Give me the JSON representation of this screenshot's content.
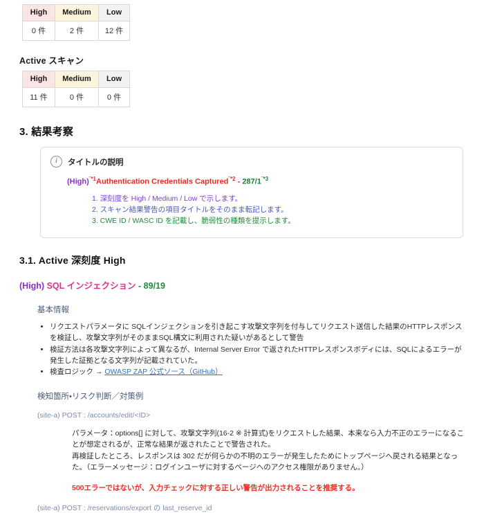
{
  "tables": [
    {
      "name": "passive-scan-summary",
      "heading": null,
      "headers": [
        "High",
        "Medium",
        "Low"
      ],
      "values": [
        "0 件",
        "2 件",
        "12 件"
      ]
    },
    {
      "name": "active-scan-summary",
      "heading": "Active スキャン",
      "headers": [
        "High",
        "Medium",
        "Low"
      ],
      "values": [
        "11 件",
        "0 件",
        "0 件"
      ]
    }
  ],
  "section3": {
    "heading": "3. 結果考察",
    "callout": {
      "icon": "info-circle-icon",
      "title": "タイトルの説明",
      "sample": {
        "severity": "(High)",
        "sup1": "¨*1",
        "name": "Authentication Credentials Captured",
        "sup2": "¨*2",
        "dash": " - ",
        "ids": "287/1",
        "sup3": "¨*3"
      },
      "notes": [
        "1. 深刻度を High / Medium / Low で示します。",
        "2. スキャン結果警告の項目タイトルをそのまま転記します。",
        "3. CWE ID / WASC ID を記載し、脆弱性の種類を提示します。"
      ]
    }
  },
  "section31": {
    "heading": "3.1. Active 深刻度 High",
    "finding": {
      "severity": "(High)",
      "name": "SQL インジェクション",
      "ids": "- 89/19"
    },
    "basic_info_heading": "基本情報",
    "bullets": [
      "リクエストパラメータに SQLインジェクションを引き起こす攻撃文字列を付与してリクエスト送信した結果のHTTPレスポンスを検証し、攻撃文字列がそのままSQL構文に利用された疑いがあるとして警告",
      "検証方法は各攻撃文字列によって異なるが、Internal Server Error で返されたHTTPレスポンスボディには、SQLによるエラーが発生した証拠となる文字列が記載されていた。"
    ],
    "bullet_link": {
      "prefix": "検査ロジック → ",
      "link_text": "OWASP ZAP 公式ソース（GitHub）"
    },
    "detect_heading": "検知箇所・リスク判断／対策例",
    "endpoints": [
      {
        "label": "(site-a) POST : /accounts/edit/<ID>",
        "paragraphs": [
          "パラメータ：options[] に対して、攻撃文字列(16-2 ※ 計算式)をリクエストした結果、本来なら入力不正のエラーになることが想定されるが、正常な結果が返されたことで警告された。",
          "再検証したところ、レスポンスは 302 だが何らかの不明のエラーが発生したためにトップページへ戻される結果となった。（エラーメッセージ：ログインユーザに対するページへのアクセス権限がありません。）"
        ],
        "warning": "500エラーではないが、入力チェックに対する正しい警告が出力されることを推奨する。"
      },
      {
        "label": "(site-a) POST : /reservations/export の last_reserve_id",
        "paragraphs": [],
        "warning": null
      }
    ]
  },
  "colors": {
    "high_header_bg": "#fbe4e4",
    "medium_header_bg": "#fdf4dc",
    "low_header_bg": "#f2f2f2",
    "severity_purple": "#8b2fc9",
    "finding_magenta": "#d6348c",
    "id_green": "#1f8a3b",
    "link_blue": "#2f6fd0",
    "warning_red": "#e8302a",
    "muted_blue": "#7d8ca8"
  }
}
